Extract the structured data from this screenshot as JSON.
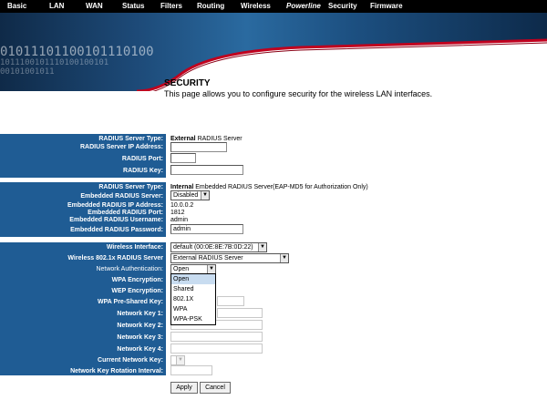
{
  "nav": {
    "items": [
      {
        "label": "Basic"
      },
      {
        "label": "LAN"
      },
      {
        "label": "WAN"
      },
      {
        "label": "Status"
      },
      {
        "label": "Filters"
      },
      {
        "label": "Routing"
      },
      {
        "label": "Wireless"
      },
      {
        "label": "Powerline"
      },
      {
        "label": "Security"
      },
      {
        "label": "Firmware"
      }
    ]
  },
  "banner": {
    "binary_line1": "01011101100101110100",
    "binary_line2": "1011100101110100100101",
    "binary_line3": "00101001011"
  },
  "page": {
    "title": "SECURITY",
    "description": "This page allows you to configure security for the wireless LAN interfaces."
  },
  "external_radius": {
    "server_type_label": "RADIUS Server Type:",
    "server_type_bold": "External",
    "server_type_rest": " RADIUS Server",
    "ip_label": "RADIUS Server IP Address:",
    "ip_value": "",
    "port_label": "RADIUS Port:",
    "port_value": "",
    "key_label": "RADIUS Key:",
    "key_value": ""
  },
  "internal_radius": {
    "server_type_label": "RADIUS Server Type:",
    "server_type_bold": "Internal",
    "server_type_rest": " Embedded RADIUS Server(EAP-MD5 for Authorization Only)",
    "embedded_label": "Embedded RADIUS Server:",
    "embedded_value": "Disabled",
    "ip_label": "Embedded RADIUS IP Address:",
    "ip_value": "10.0.0.2",
    "port_label": "Embedded RADIUS Port:",
    "port_value": "1812",
    "username_label": "Embedded RADIUS Username:",
    "username_value": "admin",
    "password_label": "Embedded RADIUS Password:",
    "password_value": "admin"
  },
  "wireless": {
    "interface_label": "Wireless Interface:",
    "interface_value": "default (00:0E:8E:7B:0D:22)",
    "radius_label": "Wireless 802.1x RADIUS Server",
    "radius_value": "External RADIUS Server",
    "auth_label": "Network Authentication:",
    "auth_value": "Open",
    "auth_options": [
      "Open",
      "Shared",
      "802.1X",
      "WPA",
      "WPA-PSK"
    ],
    "wpa_enc_label": "WPA Encryption:",
    "wep_enc_label": "WEP Encryption:",
    "psk_label": "WPA Pre-Shared Key:",
    "key1_label": "Network Key 1:",
    "key2_label": "Network Key 2:",
    "key3_label": "Network Key 3:",
    "key4_label": "Network Key 4:",
    "current_key_label": "Current Network Key:",
    "rotation_label": "Network Key Rotation Interval:"
  },
  "buttons": {
    "apply": "Apply",
    "cancel": "Cancel"
  },
  "colors": {
    "label_bg": "#1f5c94",
    "nav_bg": "#000000",
    "accent_red": "#c0001e"
  }
}
